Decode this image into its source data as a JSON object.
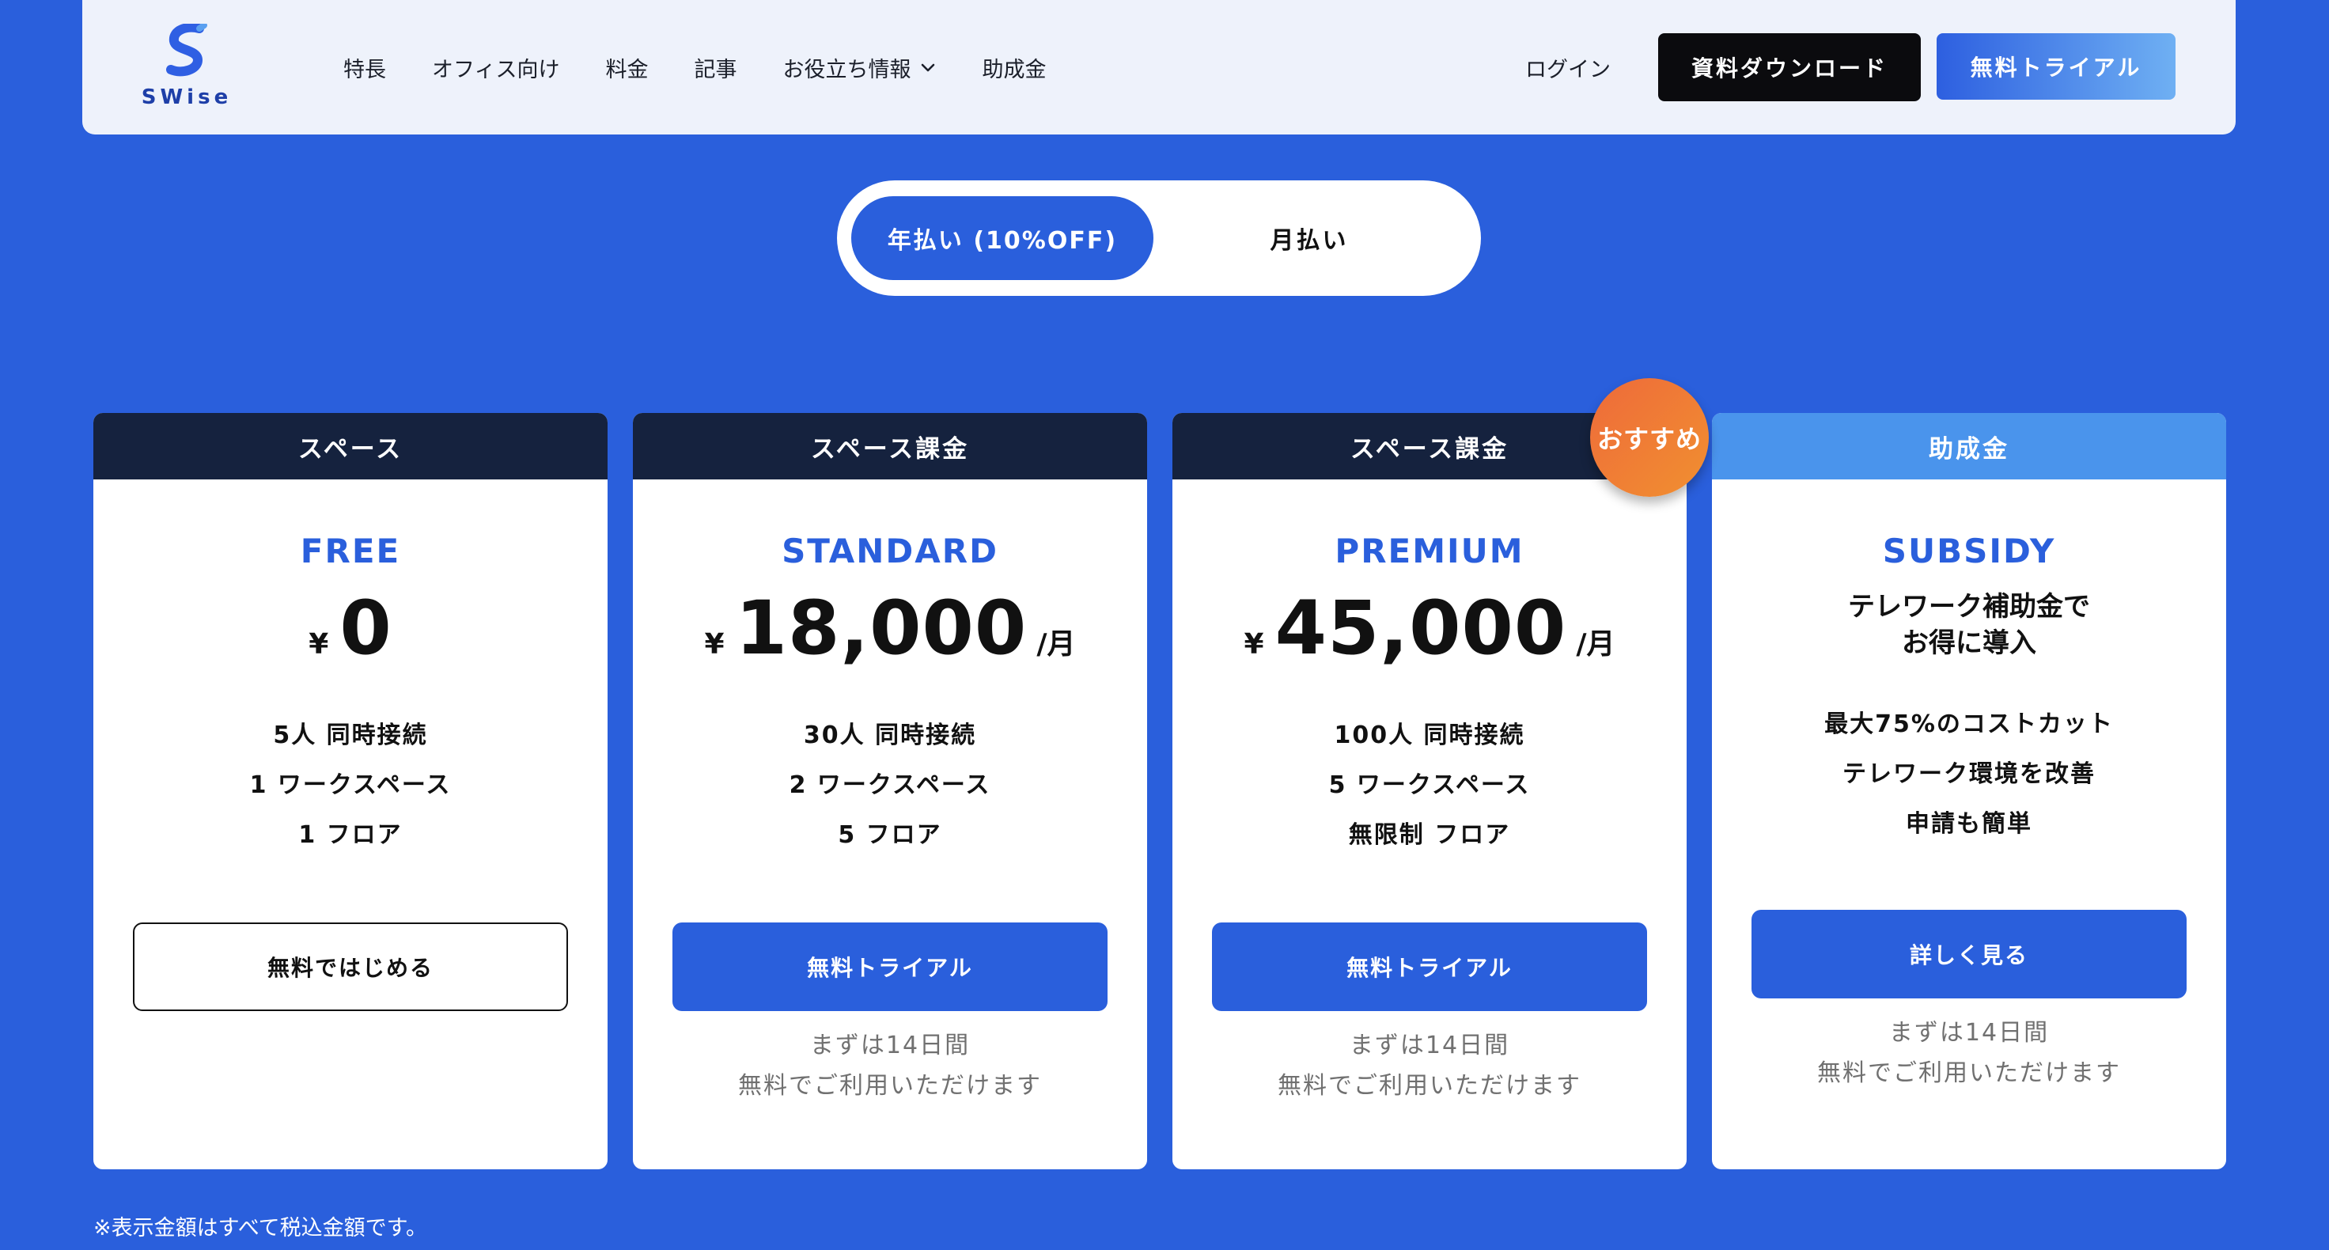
{
  "brand": {
    "logo_text": "SWise"
  },
  "nav": {
    "items": [
      "特長",
      "オフィス向け",
      "料金",
      "記事",
      "お役立ち情報",
      "助成金"
    ],
    "login": "ログイン",
    "download_label": "資料ダウンロード",
    "trial_label": "無料トライアル"
  },
  "billing": {
    "annual_label": "年払い (10%OFF)",
    "monthly_label": "月払い",
    "selected": "annual"
  },
  "badge": "おすすめ",
  "plans": [
    {
      "category": "スペース",
      "name": "FREE",
      "currency": "¥",
      "price": "0",
      "per": "",
      "features": [
        "5人 同時接続",
        "1 ワークスペース",
        "1 フロア"
      ],
      "cta": "無料ではじめる",
      "note": []
    },
    {
      "category": "スペース課金",
      "name": "STANDARD",
      "currency": "¥",
      "price": "18,000",
      "per": "/月",
      "features": [
        "30人 同時接続",
        "2 ワークスペース",
        "5 フロア"
      ],
      "cta": "無料トライアル",
      "note": [
        "まずは14日間",
        "無料でご利用いただけます"
      ]
    },
    {
      "category": "スペース課金",
      "name": "PREMIUM",
      "currency": "¥",
      "price": "45,000",
      "per": "/月",
      "features": [
        "100人 同時接続",
        "5 ワークスペース",
        "無限制 フロア"
      ],
      "cta": "無料トライアル",
      "note": [
        "まずは14日間",
        "無料でご利用いただけます"
      ]
    },
    {
      "category": "助成金",
      "name": "SUBSIDY",
      "tagline": [
        "テレワーク補助金で",
        "お得に導入"
      ],
      "features": [
        "最大75%のコストカット",
        "テレワーク環境を改善",
        "申請も簡単"
      ],
      "cta": "詳しく見る",
      "note": [
        "まずは14日間",
        "無料でご利用いただけます"
      ]
    }
  ],
  "footnote": "※表示金額はすべて税込金額です。",
  "colors": {
    "background": "#2a5fdc",
    "card_header": "#15223e",
    "subsidy_header": "#4a94ec",
    "badge": "#ef7a35"
  },
  "icons": {
    "nav_dropdown": "chevron-down-icon",
    "logo": "swise-s-logo-icon"
  }
}
